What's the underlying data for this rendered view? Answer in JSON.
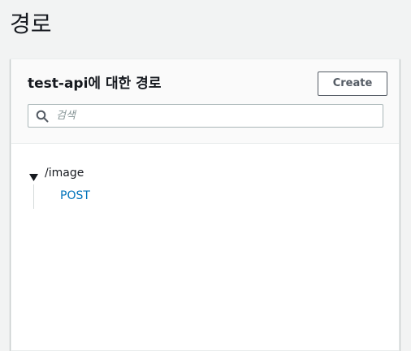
{
  "page": {
    "title": "경로"
  },
  "panel": {
    "title": "test-api에 대한 경로",
    "create_label": "Create"
  },
  "search": {
    "placeholder": "검색",
    "value": ""
  },
  "tree": {
    "resource": {
      "path": "/image",
      "expanded": true,
      "methods": [
        "POST"
      ]
    }
  },
  "icons": {
    "search": "search-icon",
    "caret": "caret-down-icon"
  },
  "colors": {
    "background": "#f2f3f3",
    "link": "#0073bb",
    "text": "#16191f",
    "button_border": "#545b64"
  }
}
